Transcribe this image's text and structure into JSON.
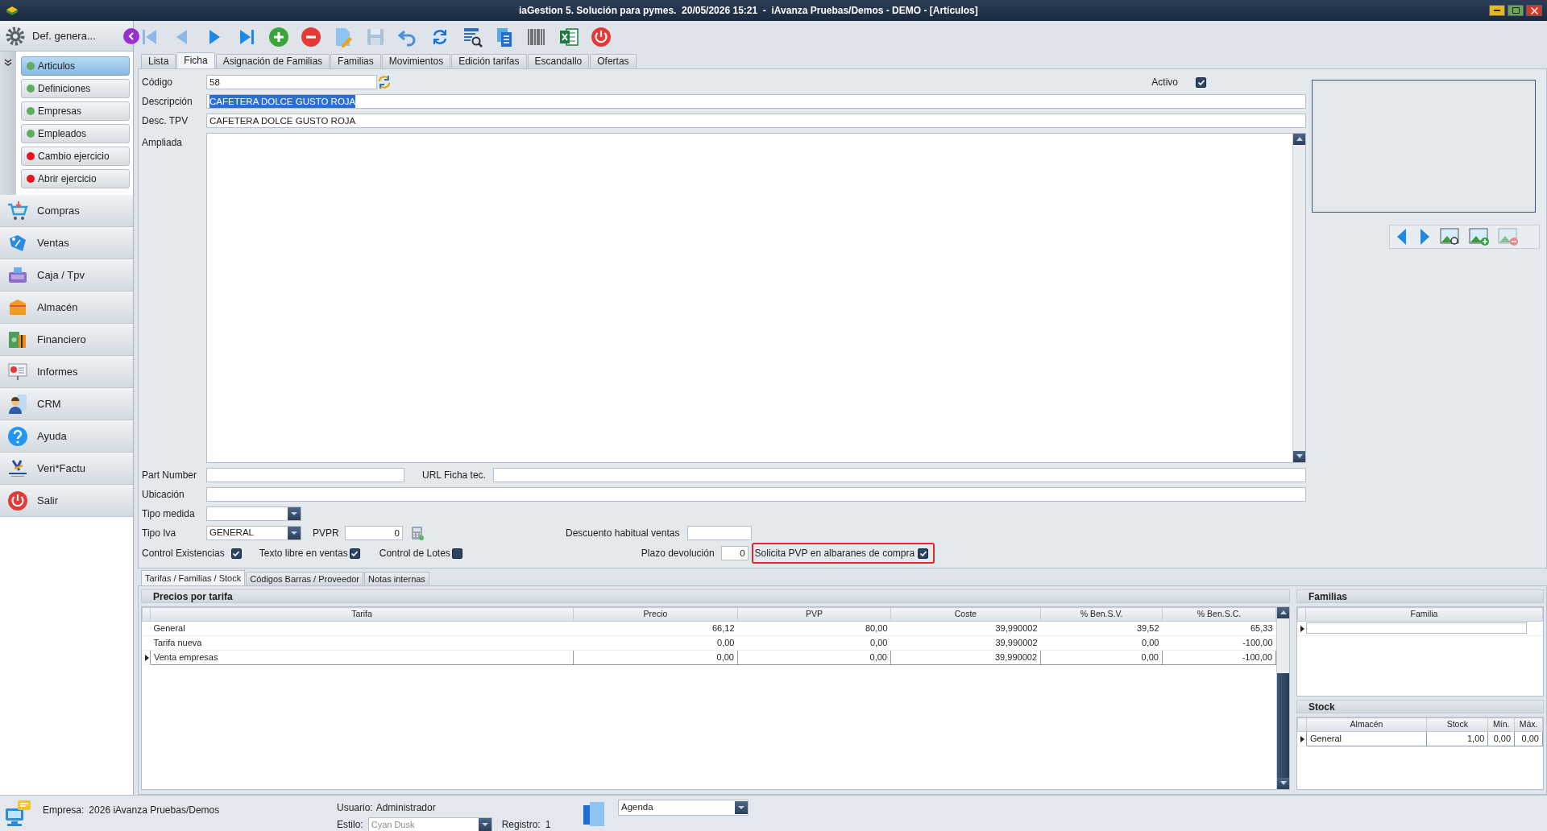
{
  "window": {
    "title": "iaGestion 5. Solución para pymes.  20/05/2026 15:21  -  iAvanza Pruebas/Demos - DEMO - [Artículos]"
  },
  "sidebar": {
    "header": "Def. genera...",
    "subitems": [
      {
        "label": "Articulos",
        "color": "#5fae5f",
        "selected": true
      },
      {
        "label": "Definiciones",
        "color": "#5fae5f",
        "selected": false
      },
      {
        "label": "Empresas",
        "color": "#5fae5f",
        "selected": false
      },
      {
        "label": "Empleados",
        "color": "#5fae5f",
        "selected": false
      },
      {
        "label": "Cambio ejercicio",
        "color": "#e8161b",
        "selected": false
      },
      {
        "label": "Abrir ejercicio",
        "color": "#e8161b",
        "selected": false
      }
    ],
    "modules": [
      {
        "label": "Compras"
      },
      {
        "label": "Ventas"
      },
      {
        "label": "Caja / Tpv"
      },
      {
        "label": "Almacén"
      },
      {
        "label": "Financiero"
      },
      {
        "label": "Informes"
      },
      {
        "label": "CRM"
      },
      {
        "label": "Ayuda"
      },
      {
        "label": "Veri*Factu"
      },
      {
        "label": "Salir"
      }
    ]
  },
  "tabs": [
    {
      "label": "Lista",
      "selected": false
    },
    {
      "label": "Ficha",
      "selected": true
    },
    {
      "label": "Asignación de Familias",
      "selected": false
    },
    {
      "label": "Familias",
      "selected": false
    },
    {
      "label": "Movimientos",
      "selected": false
    },
    {
      "label": "Edición tarifas",
      "selected": false
    },
    {
      "label": "Escandallo",
      "selected": false
    },
    {
      "label": "Ofertas",
      "selected": false
    }
  ],
  "form": {
    "codigo": {
      "label": "Código",
      "value": "58"
    },
    "activo": {
      "label": "Activo",
      "checked": true
    },
    "descripcion": {
      "label": "Descripción",
      "value": "CAFETERA DOLCE GUSTO ROJA",
      "selected": true
    },
    "desc_tpv": {
      "label": "Desc. TPV",
      "value": "CAFETERA DOLCE GUSTO ROJA"
    },
    "ampliada": {
      "label": "Ampliada"
    },
    "part_number": {
      "label": "Part Number"
    },
    "url_ficha": {
      "label": "URL Ficha tec."
    },
    "ubicacion": {
      "label": "Ubicación"
    },
    "tipo_medida": {
      "label": "Tipo medida"
    },
    "tipo_iva": {
      "label": "Tipo Iva",
      "value": "GENERAL"
    },
    "pvpr": {
      "label": "PVPR",
      "value": "0"
    },
    "descuento": {
      "label": "Descuento habitual ventas"
    },
    "checks": [
      {
        "label": "Control Existencias",
        "checked": true
      },
      {
        "label": "Texto libre en ventas",
        "checked": true
      },
      {
        "label": "Control de Lotes",
        "checked": false
      }
    ],
    "plazo": {
      "label": "Plazo devolución",
      "value": "0"
    },
    "solicita_pvp": {
      "label": "Solicita PVP en albaranes de compra",
      "checked": true,
      "highlighted": true
    }
  },
  "subtabs": [
    {
      "label": "Tarifas / Familias / Stock",
      "selected": true
    },
    {
      "label": "Códigos Barras / Proveedor",
      "selected": false
    },
    {
      "label": "Notas internas",
      "selected": false
    }
  ],
  "precios": {
    "title": "Precios por tarifa",
    "columns": [
      "Tarifa",
      "Precio",
      "PVP",
      "Coste",
      "% Ben.S.V.",
      "% Ben.S.C."
    ],
    "rows": [
      {
        "cells": [
          "General",
          "66,12",
          "80,00",
          "39,990002",
          "39,52",
          "65,33"
        ],
        "selected": false
      },
      {
        "cells": [
          "Tarifa nueva",
          "0,00",
          "0,00",
          "39,990002",
          "0,00",
          "-100,00"
        ],
        "selected": false
      },
      {
        "cells": [
          "Venta empresas",
          "0,00",
          "0,00",
          "39,990002",
          "0,00",
          "-100,00"
        ],
        "selected": true
      }
    ]
  },
  "familias": {
    "title": "Familias",
    "columns": [
      "Familia"
    ],
    "new_row": {
      "selected": true
    }
  },
  "stock": {
    "title": "Stock",
    "columns": [
      "Almacén",
      "Stock",
      "Mín.",
      "Máx."
    ],
    "rows": [
      {
        "cells": [
          "General",
          "1,00",
          "0,00",
          "0,00"
        ],
        "selected": true
      }
    ]
  },
  "status_bar": {
    "empresa_label": "Empresa:",
    "empresa": "2026 iAvanza Pruebas/Demos",
    "usuario_label": "Usuario:",
    "usuario": "Administrador",
    "estilo_label": "Estilo:",
    "estilo": {
      "value": "Cyan Dusk",
      "disabled": true
    },
    "registro_label": "Registro:",
    "registro": "1",
    "agenda": "Agenda"
  }
}
